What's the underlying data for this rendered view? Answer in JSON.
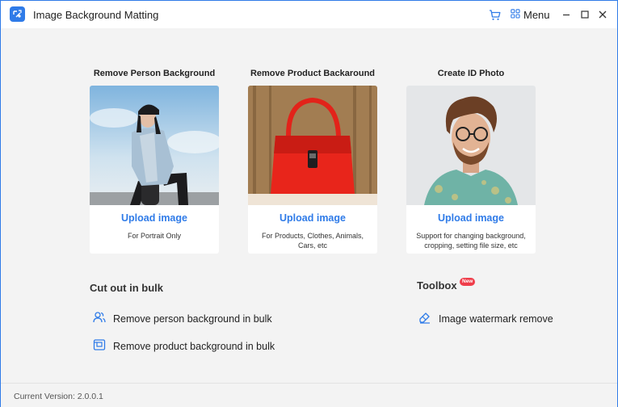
{
  "app": {
    "title": "Image Background Matting",
    "menu_label": "Menu"
  },
  "cards": [
    {
      "title": "Remove Person Background",
      "upload_label": "Upload image",
      "description": "For Portrait Only"
    },
    {
      "title": "Remove Product Backaround",
      "upload_label": "Upload image",
      "description": "For Products, Clothes, Animals, Cars, etc"
    },
    {
      "title": "Create ID Photo",
      "upload_label": "Upload image",
      "description": "Support for changing background, cropping, setting file size, etc"
    }
  ],
  "bulk": {
    "title": "Cut out in bulk",
    "items": [
      {
        "label": "Remove person background in bulk",
        "icon": "people-icon"
      },
      {
        "label": "Remove product background in bulk",
        "icon": "product-icon"
      }
    ]
  },
  "toolbox": {
    "title": "Toolbox",
    "badge": "New",
    "items": [
      {
        "label": "Image watermark remove",
        "icon": "eraser-icon"
      }
    ]
  },
  "footer": {
    "version": "Current Version: 2.0.0.1"
  },
  "colors": {
    "accent": "#2f7be8",
    "badge": "#ef3d4a",
    "background": "#f3f3f3"
  }
}
